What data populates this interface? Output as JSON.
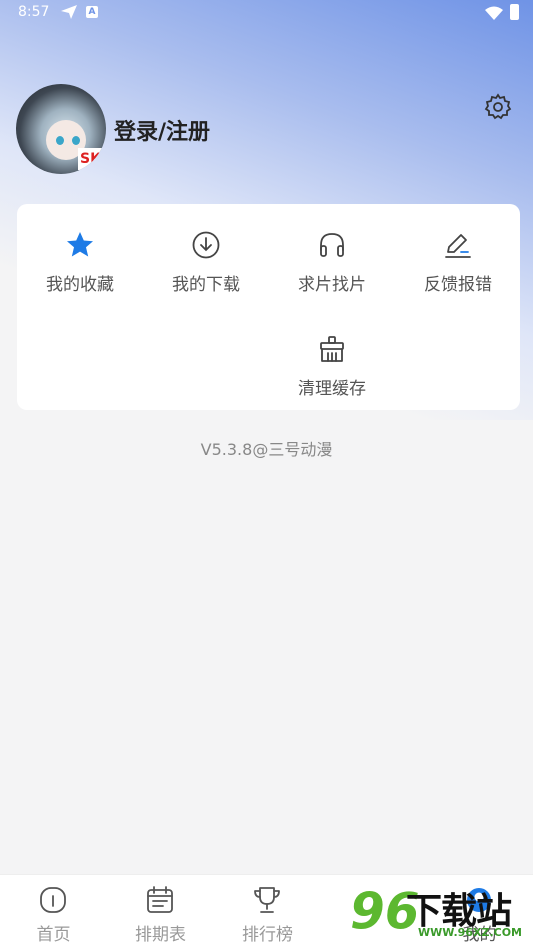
{
  "status_bar": {
    "time": "8:57",
    "a_indicator": "A"
  },
  "profile": {
    "login_label": "登录/注册",
    "avatar_tag": "SK"
  },
  "menu": {
    "items": [
      {
        "label": "我的收藏",
        "icon": "star-icon",
        "color": "#1e7be6"
      },
      {
        "label": "我的下载",
        "icon": "download-icon"
      },
      {
        "label": "求片找片",
        "icon": "headphones-icon"
      },
      {
        "label": "反馈报错",
        "icon": "edit-icon"
      },
      {
        "label": "清理缓存",
        "icon": "broom-icon"
      }
    ]
  },
  "version": "V5.3.8@三号动漫",
  "tabbar": {
    "tabs": [
      {
        "label": "首页",
        "icon": "home-icon"
      },
      {
        "label": "排期表",
        "icon": "calendar-icon"
      },
      {
        "label": "排行榜",
        "icon": "trophy-icon"
      },
      {
        "label": "我的",
        "icon": "profile-icon",
        "active": true
      }
    ]
  },
  "watermark": {
    "text": "下载站",
    "number": "96",
    "url": "WWW.96XZ.COM"
  },
  "colors": {
    "accent": "#1e7be6",
    "hero_top": "#6f93e6",
    "background": "#f4f4f5"
  }
}
